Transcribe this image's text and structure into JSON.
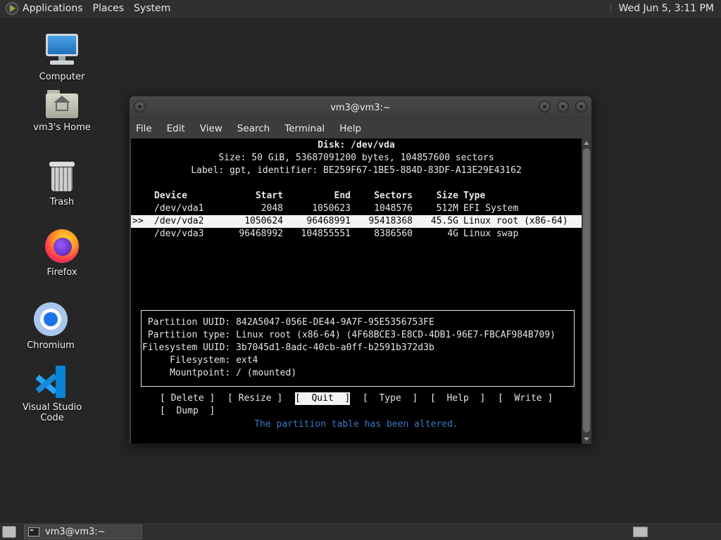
{
  "top_panel": {
    "menus": [
      "Applications",
      "Places",
      "System"
    ],
    "clock": "Wed Jun  5,  3:11 PM"
  },
  "desktop_icons": [
    {
      "label": "Computer",
      "icon": "computer-icon"
    },
    {
      "label": "vm3's Home",
      "icon": "home-folder-icon"
    },
    {
      "label": "Trash",
      "icon": "trash-icon"
    },
    {
      "label": "Firefox",
      "icon": "firefox-icon"
    },
    {
      "label": "Chromium",
      "icon": "chromium-icon"
    },
    {
      "label": "Visual Studio Code",
      "icon": "vscode-icon"
    }
  ],
  "window": {
    "title": "vm3@vm3:~",
    "menus": [
      "File",
      "Edit",
      "View",
      "Search",
      "Terminal",
      "Help"
    ]
  },
  "cfdisk": {
    "disk": "Disk: /dev/vda",
    "size": "Size: 50 GiB, 53687091200 bytes, 104857600 sectors",
    "label": "Label: gpt, identifier: BE259F67-1BE5-884D-83DF-A13E29E43162",
    "headers": {
      "device": "Device",
      "start": "Start",
      "end": "End",
      "sectors": "Sectors",
      "size": "Size",
      "type": "Type"
    },
    "selected_marker": ">>",
    "partitions": [
      {
        "device": "/dev/vda1",
        "start": "2048",
        "end": "1050623",
        "sectors": "1048576",
        "size": "512M",
        "type": "EFI System"
      },
      {
        "device": "/dev/vda2",
        "start": "1050624",
        "end": "96468991",
        "sectors": "95418368",
        "size": "45.5G",
        "type": "Linux root (x86-64)"
      },
      {
        "device": "/dev/vda3",
        "start": "96468992",
        "end": "104855551",
        "sectors": "8386560",
        "size": "4G",
        "type": "Linux swap"
      }
    ],
    "info": [
      {
        "key": " Partition UUID:",
        "value": "842A5047-056E-DE44-9A7F-95E5356753FE"
      },
      {
        "key": " Partition type:",
        "value": "Linux root (x86-64) (4F68BCE3-E8CD-4DB1-96E7-FBCAF984B709)"
      },
      {
        "key": "Filesystem UUID:",
        "value": "3b7045d1-8adc-40cb-a0ff-b2591b372d3b"
      },
      {
        "key": "     Filesystem:",
        "value": "ext4"
      },
      {
        "key": "     Mountpoint:",
        "value": "/ (mounted)"
      }
    ],
    "buttons": [
      "[ Delete ]",
      "[ Resize ]",
      "[  Quit  ]",
      "[  Type  ]",
      "[  Help  ]",
      "[  Write ]",
      "[  Dump  ]"
    ],
    "status": "The partition table has been altered."
  },
  "taskbar": {
    "task_label": "vm3@vm3:~"
  }
}
